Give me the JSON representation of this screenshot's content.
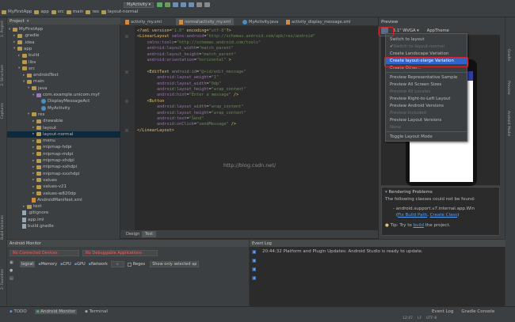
{
  "breadcrumbs": [
    "MyFirstApp",
    "app",
    "src",
    "main",
    "res",
    "layout-normal"
  ],
  "run_config": "MyActivity",
  "project_panel": {
    "title": "Project",
    "tree": [
      {
        "label": "MyFirstApp",
        "depth": 0,
        "icon": "folder-icon",
        "twisty": "▾"
      },
      {
        "label": ".gradle",
        "depth": 1,
        "icon": "folder-icon",
        "twisty": "▸"
      },
      {
        "label": ".idea",
        "depth": 1,
        "icon": "folder-icon",
        "twisty": "▸"
      },
      {
        "label": "app",
        "depth": 1,
        "icon": "folder-icon",
        "twisty": "▾"
      },
      {
        "label": "build",
        "depth": 2,
        "icon": "folder-icon",
        "twisty": "▸"
      },
      {
        "label": "libs",
        "depth": 2,
        "icon": "folder-icon",
        "twisty": ""
      },
      {
        "label": "src",
        "depth": 2,
        "icon": "folder-icon",
        "twisty": "▾"
      },
      {
        "label": "androidTest",
        "depth": 3,
        "icon": "folder-icon",
        "twisty": "▸"
      },
      {
        "label": "main",
        "depth": 3,
        "icon": "folder-icon",
        "twisty": "▾"
      },
      {
        "label": "java",
        "depth": 4,
        "icon": "folder-icon",
        "twisty": "▾"
      },
      {
        "label": "com.example.unicom.myf",
        "depth": 5,
        "icon": "package-icon",
        "twisty": "▾"
      },
      {
        "label": "DisplayMessageAct",
        "depth": 6,
        "icon": "class-icon",
        "twisty": ""
      },
      {
        "label": "MyActivity",
        "depth": 6,
        "icon": "class-icon",
        "twisty": ""
      },
      {
        "label": "res",
        "depth": 4,
        "icon": "folder-icon",
        "twisty": "▾"
      },
      {
        "label": "drawable",
        "depth": 5,
        "icon": "folder-icon",
        "twisty": "▸"
      },
      {
        "label": "layout",
        "depth": 5,
        "icon": "folder-icon",
        "twisty": "▸"
      },
      {
        "label": "layout-normal",
        "depth": 5,
        "icon": "folder-icon",
        "twisty": "▸",
        "selected": true
      },
      {
        "label": "menu",
        "depth": 5,
        "icon": "folder-icon",
        "twisty": "▸"
      },
      {
        "label": "mipmap-hdpi",
        "depth": 5,
        "icon": "folder-icon",
        "twisty": "▸"
      },
      {
        "label": "mipmap-mdpi",
        "depth": 5,
        "icon": "folder-icon",
        "twisty": "▸"
      },
      {
        "label": "mipmap-xhdpi",
        "depth": 5,
        "icon": "folder-icon",
        "twisty": "▸"
      },
      {
        "label": "mipmap-xxhdpi",
        "depth": 5,
        "icon": "folder-icon",
        "twisty": "▸"
      },
      {
        "label": "mipmap-xxxhdpi",
        "depth": 5,
        "icon": "folder-icon",
        "twisty": "▸"
      },
      {
        "label": "values",
        "depth": 5,
        "icon": "folder-icon",
        "twisty": "▸"
      },
      {
        "label": "values-v21",
        "depth": 5,
        "icon": "folder-icon",
        "twisty": "▸"
      },
      {
        "label": "values-w820dp",
        "depth": 5,
        "icon": "folder-icon",
        "twisty": "▸"
      },
      {
        "label": "AndroidManifest.xml",
        "depth": 4,
        "icon": "xml-file-icon",
        "twisty": ""
      },
      {
        "label": "test",
        "depth": 3,
        "icon": "folder-icon",
        "twisty": "▸"
      },
      {
        "label": ".gitignore",
        "depth": 2,
        "icon": "file-icon",
        "twisty": ""
      },
      {
        "label": "app.iml",
        "depth": 2,
        "icon": "file-icon",
        "twisty": ""
      },
      {
        "label": "build.gradle",
        "depth": 2,
        "icon": "file-icon",
        "twisty": ""
      }
    ]
  },
  "editor_tabs": [
    {
      "label": "activity_my.xml",
      "active": false
    },
    {
      "label": "normal\\activity_my.xml",
      "active": true
    },
    {
      "label": "MyActivity.java",
      "active": false
    },
    {
      "label": "activity_display_message.xml",
      "active": false
    }
  ],
  "code_lines": [
    [
      [
        "tg",
        "<?xml version="
      ],
      [
        "av",
        "\"1.0\""
      ],
      [
        "tg",
        " encoding="
      ],
      [
        "av",
        "\"utf-8\""
      ],
      [
        "tg",
        "?>"
      ]
    ],
    [
      [
        "tg",
        "<LinearLayout "
      ],
      [
        "ns",
        "xmlns:android"
      ],
      [
        "at",
        "="
      ],
      [
        "av",
        "\"http://schemas.android.com/apk/res/android\""
      ]
    ],
    [
      [
        "at",
        "    "
      ],
      [
        "ns",
        "xmlns:tools"
      ],
      [
        "at",
        "="
      ],
      [
        "av",
        "\"http://schemas.android.com/tools\""
      ]
    ],
    [
      [
        "at",
        "    "
      ],
      [
        "ns",
        "android:layout_width"
      ],
      [
        "at",
        "="
      ],
      [
        "av",
        "\"match_parent\""
      ]
    ],
    [
      [
        "at",
        "    "
      ],
      [
        "ns",
        "android:layout_height"
      ],
      [
        "at",
        "="
      ],
      [
        "av",
        "\"match_parent\""
      ]
    ],
    [
      [
        "at",
        "    "
      ],
      [
        "ns",
        "android:orientation"
      ],
      [
        "at",
        "="
      ],
      [
        "av",
        "\"horizontal\""
      ],
      [
        "tg",
        " >"
      ]
    ],
    [
      [
        "at",
        ""
      ]
    ],
    [
      [
        "tg",
        "    <EditText "
      ],
      [
        "ns",
        "android:id"
      ],
      [
        "at",
        "="
      ],
      [
        "av",
        "\"@+id/edit_message\""
      ]
    ],
    [
      [
        "at",
        "        "
      ],
      [
        "ns",
        "android:layout_weight"
      ],
      [
        "at",
        "="
      ],
      [
        "av",
        "\"1\""
      ]
    ],
    [
      [
        "at",
        "        "
      ],
      [
        "ns",
        "android:layout_width"
      ],
      [
        "at",
        "="
      ],
      [
        "av",
        "\"0dp\""
      ]
    ],
    [
      [
        "at",
        "        "
      ],
      [
        "ns",
        "android:layout_height"
      ],
      [
        "at",
        "="
      ],
      [
        "av",
        "\"wrap_content\""
      ]
    ],
    [
      [
        "at",
        "        "
      ],
      [
        "ns",
        "android:hint"
      ],
      [
        "at",
        "="
      ],
      [
        "av",
        "\"Enter a message\""
      ],
      [
        "tg",
        " />"
      ]
    ],
    [
      [
        "tg",
        "    <Button"
      ]
    ],
    [
      [
        "at",
        "        "
      ],
      [
        "ns",
        "android:layout_width"
      ],
      [
        "at",
        "="
      ],
      [
        "av",
        "\"wrap_content\""
      ]
    ],
    [
      [
        "at",
        "        "
      ],
      [
        "ns",
        "android:layout_height"
      ],
      [
        "at",
        "="
      ],
      [
        "av",
        "\"wrap_content\""
      ]
    ],
    [
      [
        "at",
        "        "
      ],
      [
        "ns",
        "android:text"
      ],
      [
        "at",
        "="
      ],
      [
        "av",
        "\"Send\""
      ]
    ],
    [
      [
        "at",
        "        "
      ],
      [
        "ns",
        "android:onClick"
      ],
      [
        "at",
        "="
      ],
      [
        "av",
        "\"sendMessage\""
      ],
      [
        "tg",
        " />"
      ]
    ],
    [
      [
        "tg",
        "</LinearLayout>"
      ]
    ]
  ],
  "watermark": "http://blog.csdn.net/",
  "design_tabs": [
    "Design",
    "Text"
  ],
  "preview": {
    "title": "Preview",
    "device_label": "5.1\" WVGA",
    "theme_label": "AppTheme",
    "dropdown": [
      {
        "label": "Switch to layout",
        "state": "normal"
      },
      {
        "label": "Switch to layout-normal",
        "state": "disabled"
      },
      {
        "label": "Create Landscape Variation",
        "state": "normal"
      },
      {
        "label": "Create layout-xlarge Variation",
        "state": "highlighted"
      },
      {
        "label": "Create Other...",
        "state": "normal"
      },
      {
        "sep": true
      },
      {
        "label": "Preview Representative Sample",
        "state": "normal"
      },
      {
        "label": "Preview All Screen Sizes",
        "state": "normal"
      },
      {
        "label": "Preview All Locales",
        "state": "disabled"
      },
      {
        "label": "Preview Right-to-Left Layout",
        "state": "normal"
      },
      {
        "label": "Preview Android Versions",
        "state": "normal"
      },
      {
        "label": "Preview Included",
        "state": "disabled"
      },
      {
        "label": "Preview Layout Versions",
        "state": "normal"
      },
      {
        "label": "None",
        "state": "disabled"
      },
      {
        "sep": true
      },
      {
        "label": "Toggle Layout Mode",
        "state": "normal"
      }
    ],
    "rendering": {
      "title": "Rendering Problems",
      "line1": "The following classes could not be found:",
      "line2": "- android.support.v7.internal.app.Win",
      "fix_build_path": "Fix Build Path",
      "comma": ",",
      "create_class": "Create Class",
      "tip_prefix": "Tip: Try to",
      "tip_link": "build",
      "tip_suffix": "the project."
    }
  },
  "monitor": {
    "title": "Android Monitor",
    "no_devices": "No Connected Devices",
    "no_debuggable": "No Debuggable Applications",
    "tabs": [
      "logcat",
      "Memory",
      "CPU",
      "GPU",
      "Network"
    ],
    "regex": "Regex",
    "filter": "Show only selected ap"
  },
  "event_log": {
    "title": "Event Log",
    "entry": "20:44:32 Platform and Plugin Updates: Android Studio is ready to update."
  },
  "status_bar": {
    "tabs": [
      "TODO",
      "Android Monitor",
      "Terminal"
    ],
    "right_tabs": [
      "Event Log",
      "Gradle Console"
    ],
    "position": "12:47",
    "line_sep": "LF",
    "encoding": "UTF-8"
  },
  "left_tool_tabs": [
    "1: Project",
    "2: Structure",
    "Captures",
    "Build Variants",
    "2: Favorites"
  ],
  "right_tool_tabs": [
    "Gradle",
    "Preview",
    "Android Model"
  ],
  "colors": {
    "accent_highlight": "#2f65ca",
    "annotation_red": "#d1262f"
  }
}
